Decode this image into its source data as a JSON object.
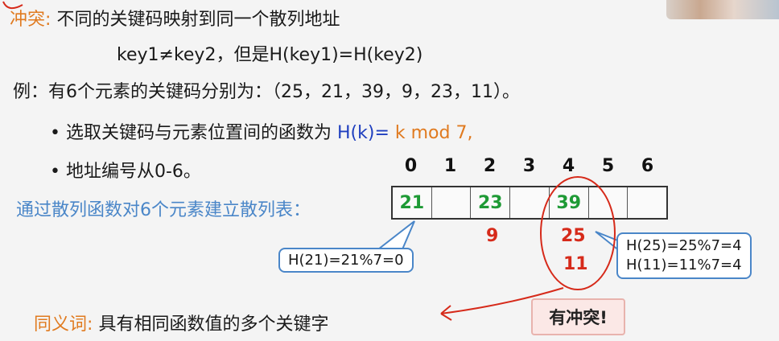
{
  "conflict_def": {
    "term": "冲突",
    "colon": ":",
    "text": "不同的关键码映射到同一个散列地址",
    "formula": "key1≠key2，但是H(key1)=H(key2)"
  },
  "example": {
    "text": "例：有6个元素的关键码分别为：（25，21，39，9，23，11）。"
  },
  "bullets": [
    {
      "dot": "•",
      "prefix": "选取关键码与元素位置间的函数为",
      "fn": "H(k)=",
      "fn2": " k mod 7,"
    },
    {
      "dot": "•",
      "text": "地址编号从0-6。"
    }
  ],
  "table_label": "通过散列函数对6个元素建立散列表：",
  "indices": [
    "0",
    "1",
    "2",
    "3",
    "4",
    "5",
    "6"
  ],
  "cells": [
    "21",
    "",
    "23",
    "",
    "39",
    "",
    ""
  ],
  "below": {
    "col2": "9",
    "col4a": "25",
    "col4b": "11"
  },
  "callout_left": "H(21)=21%7=0",
  "callout_right": [
    "H(25)=25%7=4",
    "H(11)=11%7=4"
  ],
  "synonym": {
    "term": "同义词",
    "colon": ":",
    "text": "具有相同函数值的多个关键字"
  },
  "conflict_button": "有冲突!",
  "colors": {
    "orange": "#e07a1f",
    "blue": "#1f3fbf",
    "green": "#1e9a35",
    "red": "#d62a1a",
    "callout_border": "#4a86c8"
  }
}
